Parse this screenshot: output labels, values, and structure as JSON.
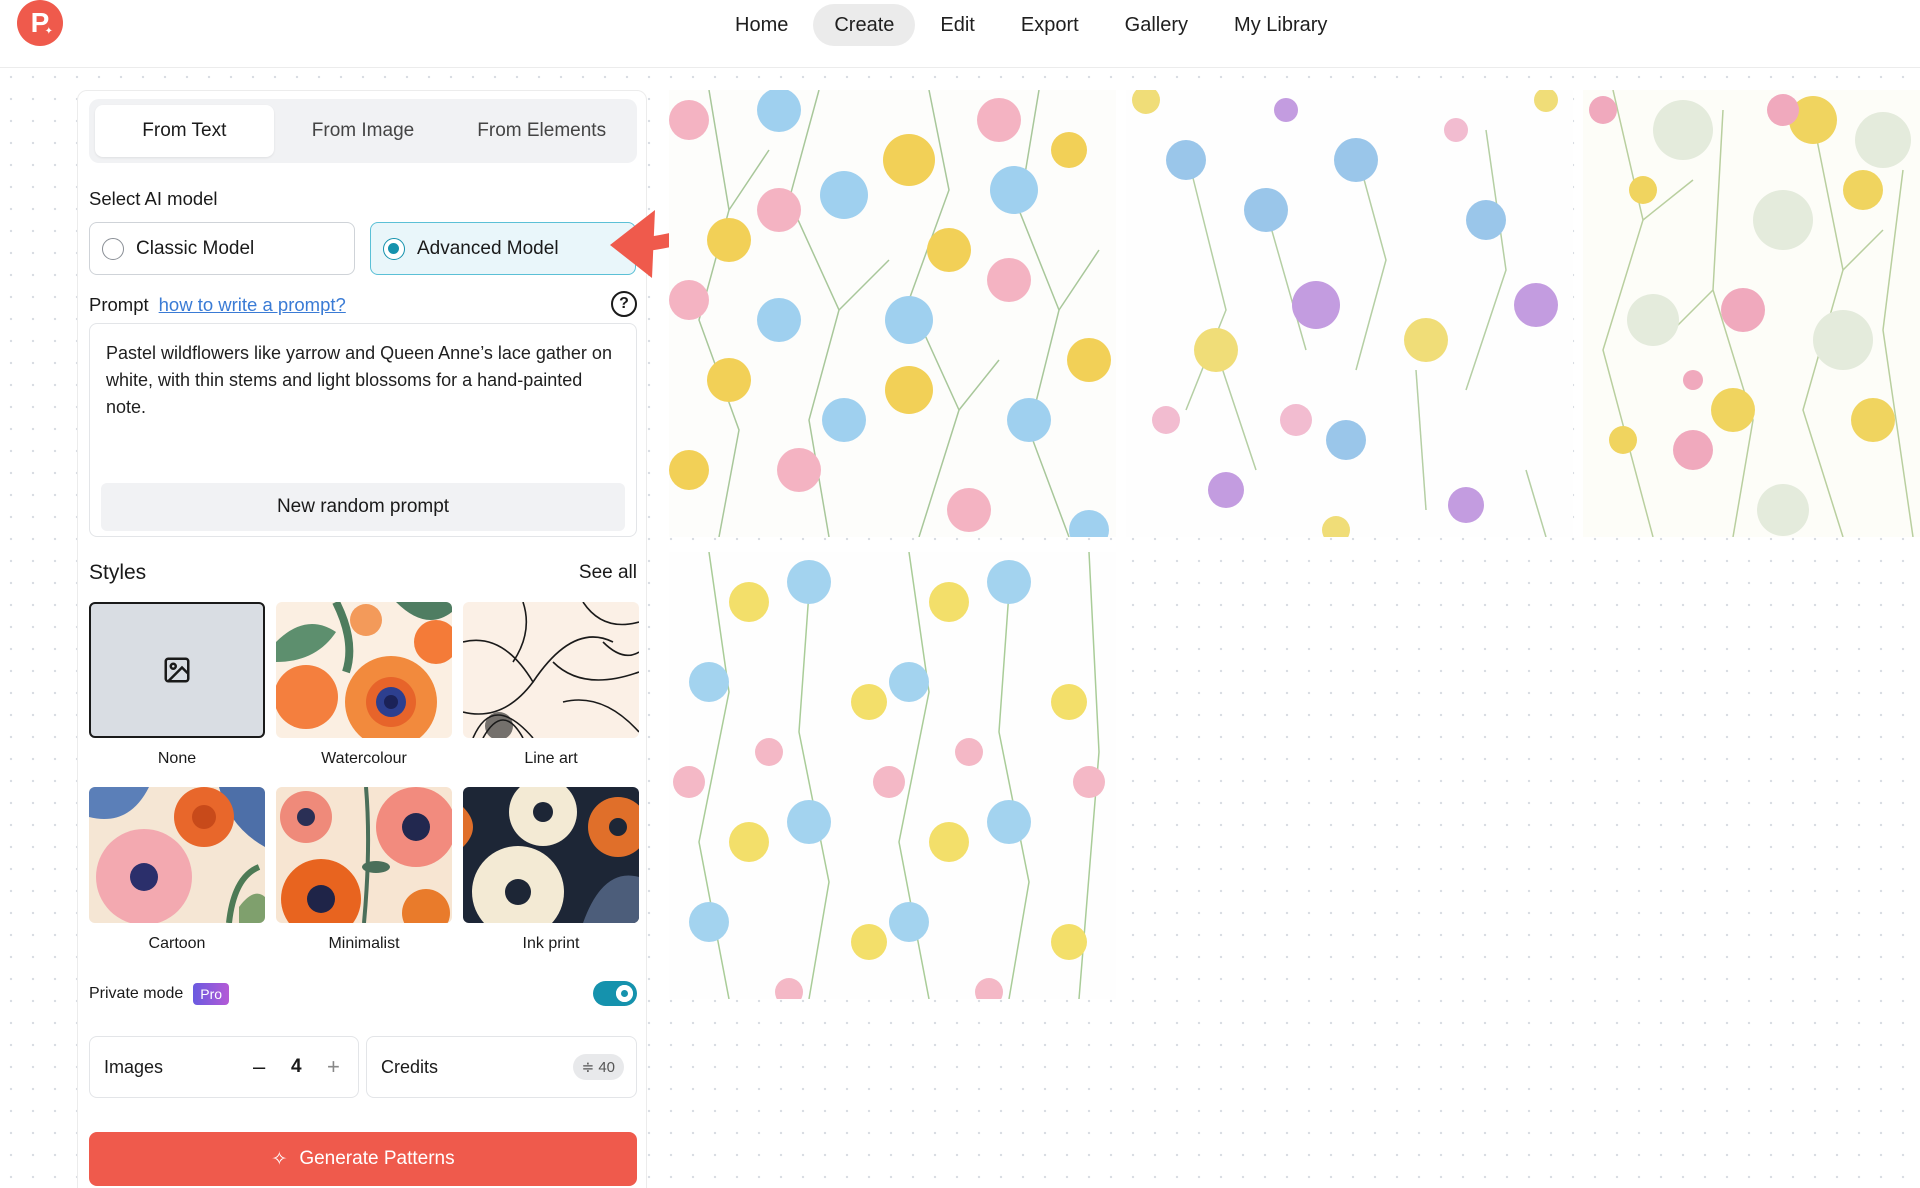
{
  "nav": {
    "items": [
      {
        "label": "Home"
      },
      {
        "label": "Create",
        "active": true
      },
      {
        "label": "Edit"
      },
      {
        "label": "Export"
      },
      {
        "label": "Gallery"
      },
      {
        "label": "My Library"
      }
    ]
  },
  "brand": {
    "logo_letter": "P",
    "color": "#ef5a4c"
  },
  "tabs": [
    {
      "label": "From Text",
      "active": true
    },
    {
      "label": "From Image"
    },
    {
      "label": "From Elements"
    }
  ],
  "model": {
    "section_label": "Select AI model",
    "options": [
      {
        "label": "Classic Model",
        "selected": false
      },
      {
        "label": "Advanced Model",
        "selected": true
      }
    ]
  },
  "prompt": {
    "label": "Prompt",
    "help_link": "how to write a prompt?",
    "help_icon": "question-circle-icon",
    "text": "Pastel wildflowers like yarrow and Queen Anne’s lace gather on white, with thin stems and light blossoms for a hand-painted note.",
    "random_button": "New random prompt"
  },
  "styles": {
    "title": "Styles",
    "see_all": "See all",
    "items": [
      {
        "label": "None",
        "selected": true
      },
      {
        "label": "Watercolour"
      },
      {
        "label": "Line art"
      },
      {
        "label": "Cartoon"
      },
      {
        "label": "Minimalist"
      },
      {
        "label": "Ink print"
      }
    ]
  },
  "private_mode": {
    "label": "Private mode",
    "badge": "Pro",
    "enabled": true
  },
  "images": {
    "label": "Images",
    "count": "4",
    "minus": "–",
    "plus": "+"
  },
  "credits": {
    "label": "Credits",
    "value": "40"
  },
  "generate": {
    "label": "Generate Patterns",
    "color": "#ef5a4c"
  },
  "accent_color": "#1592ad"
}
